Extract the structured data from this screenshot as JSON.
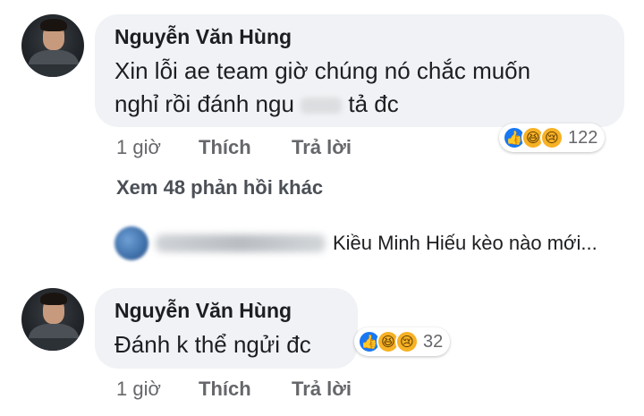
{
  "comment1": {
    "author": "Nguyễn Văn Hùng",
    "text_line1": "Xin lỗi ae team giờ chúng nó chắc muốn",
    "text_line2_before": "nghỉ rồi đánh ngu ",
    "text_line2_after": " tả đc",
    "time": "1 giờ",
    "like_label": "Thích",
    "reply_label": "Trả lời",
    "reaction_icons": [
      "like-icon",
      "haha-icon",
      "sad-icon"
    ],
    "reaction_count": "122"
  },
  "more_replies_label": "Xem 48 phản hồi khác",
  "reply_preview": {
    "text": "Kiều Minh Hiếu kèo nào mới..."
  },
  "comment2": {
    "author": "Nguyễn Văn Hùng",
    "text": "Đánh k thể ngửi đc",
    "time": "1 giờ",
    "like_label": "Thích",
    "reply_label": "Trả lời",
    "reaction_icons": [
      "like-icon",
      "haha-icon",
      "sad-icon"
    ],
    "reaction_count": "32"
  },
  "colors": {
    "bubble_bg": "#f0f2f5",
    "meta_text": "#65676b",
    "like_blue": "#1877f2",
    "emoji_yellow": "#f7b125"
  }
}
